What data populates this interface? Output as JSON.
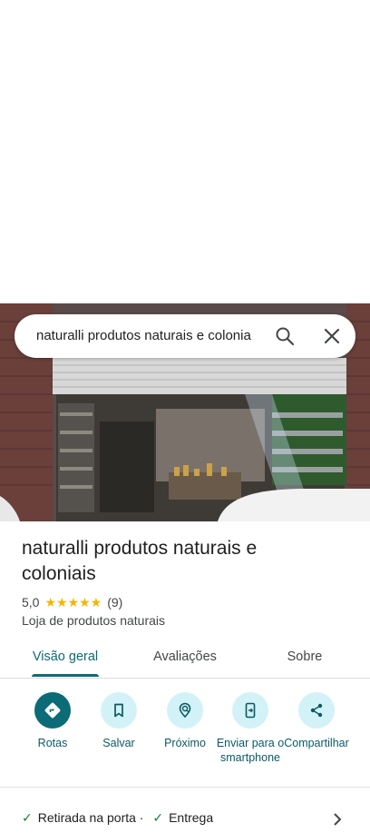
{
  "search": {
    "query": "naturalli produtos naturais e colonia"
  },
  "place": {
    "name": "naturalli produtos naturais e coloniais",
    "rating": "5,0",
    "stars": "★★★★★",
    "review_count": "(9)",
    "category": "Loja de produtos naturais"
  },
  "tabs": [
    {
      "label": "Visão geral",
      "active": true
    },
    {
      "label": "Avaliações",
      "active": false
    },
    {
      "label": "Sobre",
      "active": false
    }
  ],
  "actions": [
    {
      "label": "Rotas",
      "icon": "directions-icon"
    },
    {
      "label": "Salvar",
      "icon": "bookmark-icon"
    },
    {
      "label": "Próximo",
      "icon": "nearby-icon"
    },
    {
      "label": "Enviar para o smartphone",
      "icon": "send-to-phone-icon"
    },
    {
      "label": "Compartilhar",
      "icon": "share-icon"
    }
  ],
  "services": {
    "item1": "Retirada na porta ·",
    "item2": "Entrega"
  },
  "colors": {
    "accent": "#0b6b77",
    "accent_light": "#d3f2f7",
    "star": "#f5b400",
    "check": "#188038"
  }
}
